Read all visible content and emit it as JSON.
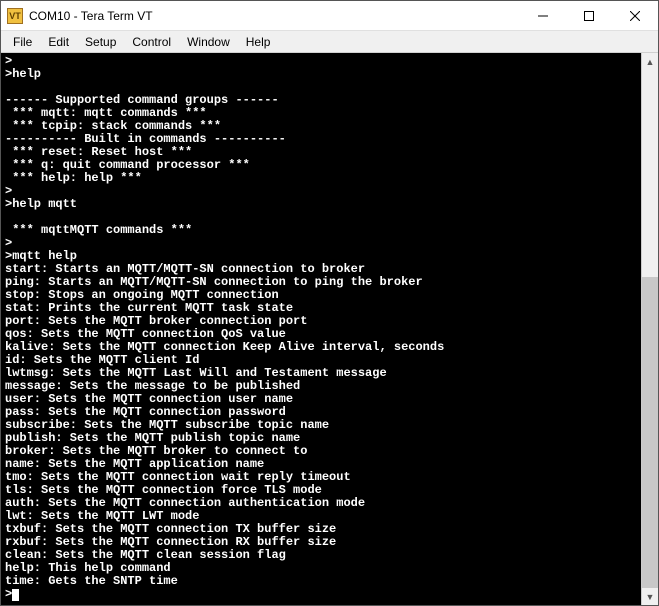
{
  "window": {
    "icon_text": "VT",
    "title": "COM10 - Tera Term VT"
  },
  "menu": {
    "items": [
      "File",
      "Edit",
      "Setup",
      "Control",
      "Window",
      "Help"
    ]
  },
  "terminal": {
    "lines": [
      ">",
      ">help",
      "",
      "------ Supported command groups ------",
      " *** mqtt: mqtt commands ***",
      " *** tcpip: stack commands ***",
      "---------- Built in commands ----------",
      " *** reset: Reset host ***",
      " *** q: quit command processor ***",
      " *** help: help ***",
      ">",
      ">help mqtt",
      "",
      " *** mqttMQTT commands ***",
      ">",
      ">mqtt help",
      "start: Starts an MQTT/MQTT-SN connection to broker",
      "ping: Starts an MQTT/MQTT-SN connection to ping the broker",
      "stop: Stops an ongoing MQTT connection",
      "stat: Prints the current MQTT task state",
      "port: Sets the MQTT broker connection port",
      "qos: Sets the MQTT connection QoS value",
      "kalive: Sets the MQTT connection Keep Alive interval, seconds",
      "id: Sets the MQTT client Id",
      "lwtmsg: Sets the MQTT Last Will and Testament message",
      "message: Sets the message to be published",
      "user: Sets the MQTT connection user name",
      "pass: Sets the MQTT connection password",
      "subscribe: Sets the MQTT subscribe topic name",
      "publish: Sets the MQTT publish topic name",
      "broker: Sets the MQTT broker to connect to",
      "name: Sets the MQTT application name",
      "tmo: Sets the MQTT connection wait reply timeout",
      "tls: Sets the MQTT connection force TLS mode",
      "auth: Sets the MQTT connection authentication mode",
      "lwt: Sets the MQTT LWT mode",
      "txbuf: Sets the MQTT connection TX buffer size",
      "rxbuf: Sets the MQTT connection RX buffer size",
      "clean: Sets the MQTT clean session flag",
      "help: This help command",
      "time: Gets the SNTP time"
    ],
    "prompt": ">"
  }
}
